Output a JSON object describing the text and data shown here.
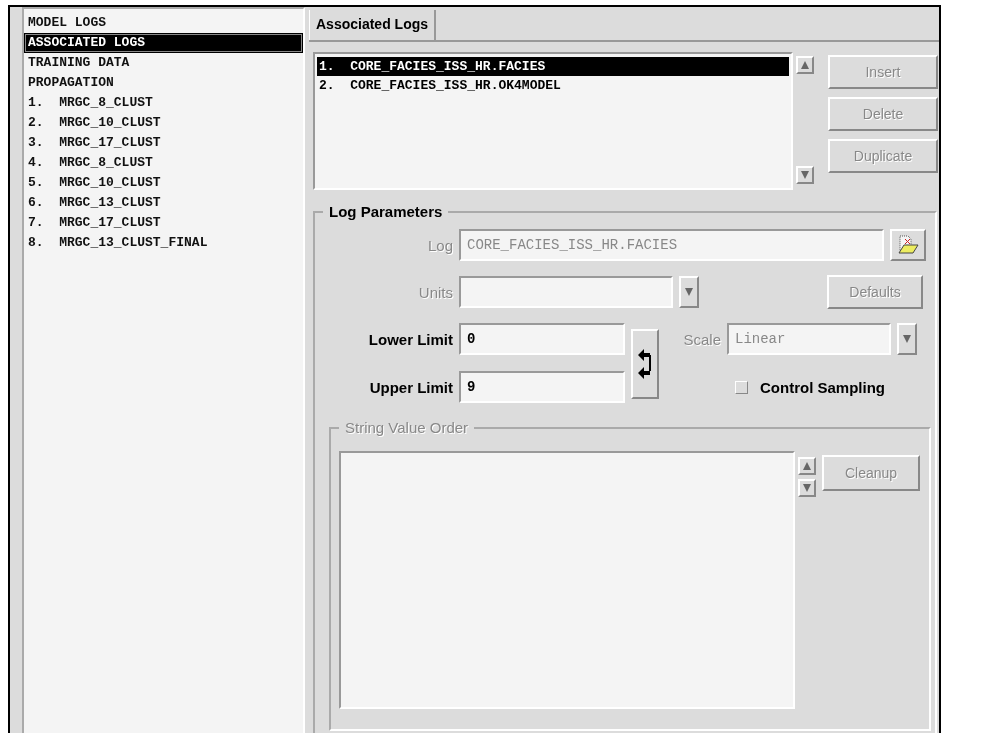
{
  "sidebar": {
    "items": [
      {
        "label": "MODEL LOGS",
        "selected": false
      },
      {
        "label": "ASSOCIATED LOGS",
        "selected": true
      },
      {
        "label": "TRAINING DATA",
        "selected": false
      },
      {
        "label": "PROPAGATION",
        "selected": false
      },
      {
        "label": "1.  MRGC_8_CLUST",
        "selected": false
      },
      {
        "label": "2.  MRGC_10_CLUST",
        "selected": false
      },
      {
        "label": "3.  MRGC_17_CLUST",
        "selected": false
      },
      {
        "label": "4.  MRGC_8_CLUST",
        "selected": false
      },
      {
        "label": "5.  MRGC_10_CLUST",
        "selected": false
      },
      {
        "label": "6.  MRGC_13_CLUST",
        "selected": false
      },
      {
        "label": "7.  MRGC_17_CLUST",
        "selected": false
      },
      {
        "label": "8.  MRGC_13_CLUST_FINAL",
        "selected": false
      }
    ]
  },
  "tabs": [
    {
      "label": "Associated Logs",
      "selected": true
    }
  ],
  "logs_list": {
    "items": [
      {
        "label": "1.  CORE_FACIES_ISS_HR.FACIES",
        "selected": true
      },
      {
        "label": "2.  CORE_FACIES_ISS_HR.OK4MODEL",
        "selected": false
      }
    ]
  },
  "list_buttons": [
    {
      "label": "Insert",
      "disabled": true
    },
    {
      "label": "Delete",
      "disabled": true
    },
    {
      "label": "Duplicate",
      "disabled": true
    }
  ],
  "log_parameters": {
    "title": "Log Parameters",
    "log": {
      "label": "Log",
      "value": "CORE_FACIES_ISS_HR.FACIES",
      "disabled": true
    },
    "units": {
      "label": "Units",
      "disabled": true
    },
    "defaults_button": {
      "label": "Defaults",
      "disabled": true
    },
    "lower_limit": {
      "label": "Lower Limit",
      "value": "0",
      "disabled": false
    },
    "upper_limit": {
      "label": "Upper Limit",
      "value": "9",
      "disabled": false
    },
    "scale": {
      "label": "Scale",
      "value": "Linear",
      "disabled": true
    },
    "control_sampling": {
      "label": "Control Sampling",
      "checked": false
    }
  },
  "string_value_order": {
    "title": "String Value Order",
    "disabled": true,
    "cleanup_button": {
      "label": "Cleanup",
      "disabled": true
    }
  }
}
